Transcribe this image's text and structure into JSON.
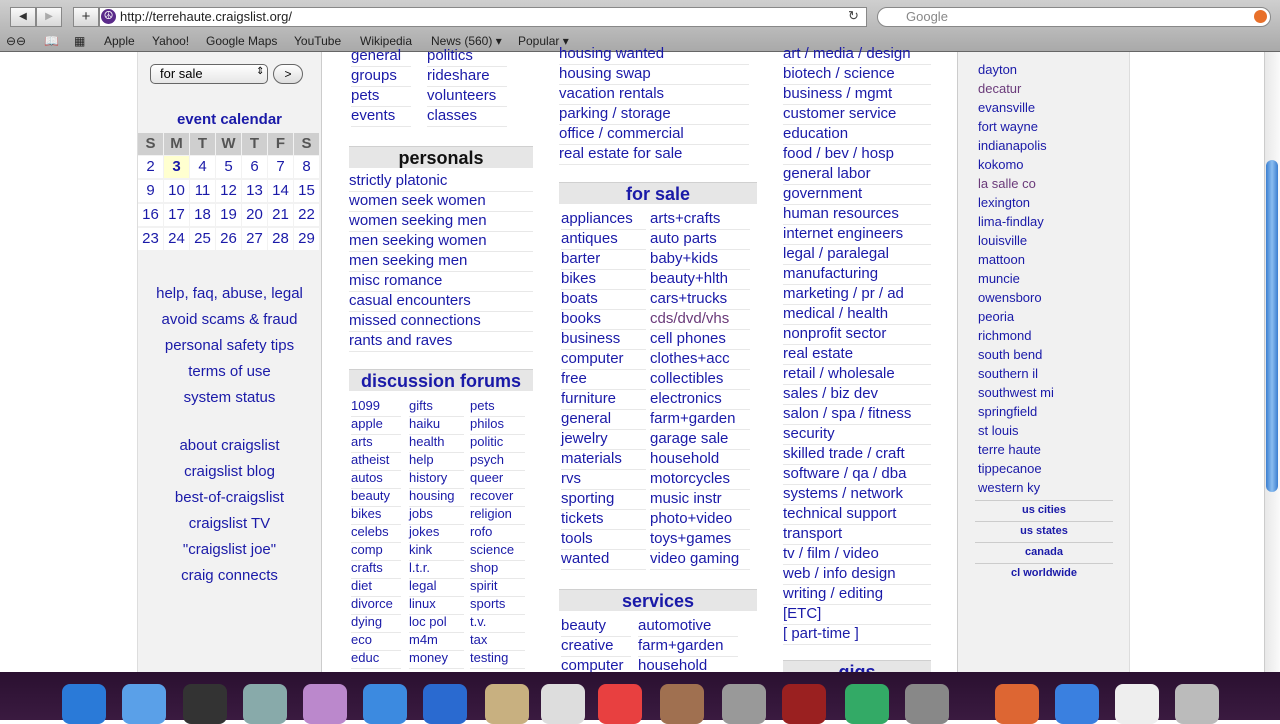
{
  "browser": {
    "url": "http://terrehaute.craigslist.org/",
    "search_placeholder": "Google",
    "bookmarks": [
      "Apple",
      "Yahoo!",
      "Google Maps",
      "YouTube",
      "Wikipedia",
      "News (560) ▾",
      "Popular ▾"
    ]
  },
  "search": {
    "category": "for sale",
    "go": ">"
  },
  "calendar": {
    "title": "event calendar",
    "days": [
      "S",
      "M",
      "T",
      "W",
      "T",
      "F",
      "S"
    ],
    "weeks": [
      [
        "2",
        "3",
        "4",
        "5",
        "6",
        "7",
        "8"
      ],
      [
        "9",
        "10",
        "11",
        "12",
        "13",
        "14",
        "15"
      ],
      [
        "16",
        "17",
        "18",
        "19",
        "20",
        "21",
        "22"
      ],
      [
        "23",
        "24",
        "25",
        "26",
        "27",
        "28",
        "29"
      ]
    ],
    "today": "3"
  },
  "left_links": [
    "help, faq, abuse, legal",
    "avoid scams & fraud",
    "personal safety tips",
    "terms of use",
    "system status"
  ],
  "left_links2": [
    "about craigslist",
    "craigslist blog",
    "best-of-craigslist",
    "craigslist TV",
    "\"craigslist joe\"",
    "craig connects"
  ],
  "community": {
    "col1": [
      "general",
      "groups",
      "pets",
      "events"
    ],
    "col2": [
      "politics",
      "rideshare",
      "volunteers",
      "classes"
    ]
  },
  "personals": {
    "title": "personals",
    "items": [
      "strictly platonic",
      "women seek women",
      "women seeking men",
      "men seeking women",
      "men seeking men",
      "misc romance",
      "casual encounters",
      "missed connections",
      "rants and raves"
    ]
  },
  "forums": {
    "title": "discussion forums",
    "col1": [
      "1099",
      "apple",
      "arts",
      "atheist",
      "autos",
      "beauty",
      "bikes",
      "celebs",
      "comp",
      "crafts",
      "diet",
      "divorce",
      "dying",
      "eco",
      "educ"
    ],
    "col2": [
      "gifts",
      "haiku",
      "health",
      "help",
      "history",
      "housing",
      "jobs",
      "jokes",
      "kink",
      "l.t.r.",
      "legal",
      "linux",
      "loc pol",
      "m4m",
      "money"
    ],
    "col3": [
      "pets",
      "philos",
      "politic",
      "psych",
      "queer",
      "recover",
      "religion",
      "rofo",
      "science",
      "shop",
      "spirit",
      "sports",
      "t.v.",
      "tax",
      "testing"
    ]
  },
  "housing": {
    "items": [
      "housing wanted",
      "housing swap",
      "vacation rentals",
      "parking / storage",
      "office / commercial",
      "real estate for sale"
    ]
  },
  "for_sale": {
    "title": "for sale",
    "col1": [
      "appliances",
      "antiques",
      "barter",
      "bikes",
      "boats",
      "books",
      "business",
      "computer",
      "free",
      "furniture",
      "general",
      "jewelry",
      "materials",
      "rvs",
      "sporting",
      "tickets",
      "tools",
      "wanted"
    ],
    "col2": [
      "arts+crafts",
      "auto parts",
      "baby+kids",
      "beauty+hlth",
      "cars+trucks",
      "cds/dvd/vhs",
      "cell phones",
      "clothes+acc",
      "collectibles",
      "electronics",
      "farm+garden",
      "garage sale",
      "household",
      "motorcycles",
      "music instr",
      "photo+video",
      "toys+games",
      "video gaming"
    ]
  },
  "services": {
    "title": "services",
    "col1": [
      "beauty",
      "creative",
      "computer"
    ],
    "col2": [
      "automotive",
      "farm+garden",
      "household"
    ]
  },
  "jobs": {
    "items": [
      "art / media / design",
      "biotech / science",
      "business / mgmt",
      "customer service",
      "education",
      "food / bev / hosp",
      "general labor",
      "government",
      "human resources",
      "internet engineers",
      "legal / paralegal",
      "manufacturing",
      "marketing / pr / ad",
      "medical / health",
      "nonprofit sector",
      "real estate",
      "retail / wholesale",
      "sales / biz dev",
      "salon / spa / fitness",
      "security",
      "skilled trade / craft",
      "software / qa / dba",
      "systems / network",
      "technical support",
      "transport",
      "tv / film / video",
      "web / info design",
      "writing / editing",
      "[ETC]",
      "[ part-time ]"
    ]
  },
  "gigs": {
    "title": "gigs"
  },
  "nearby": {
    "items": [
      "dayton",
      "decatur",
      "evansville",
      "fort wayne",
      "indianapolis",
      "kokomo",
      "la salle co",
      "lexington",
      "lima-findlay",
      "louisville",
      "mattoon",
      "muncie",
      "owensboro",
      "peoria",
      "richmond",
      "south bend",
      "southern il",
      "southwest mi",
      "springfield",
      "st louis",
      "terre haute",
      "tippecanoe",
      "western ky"
    ],
    "visited": [
      "decatur",
      "la salle co"
    ],
    "more": [
      "us cities",
      "us states",
      "canada",
      "cl worldwide"
    ]
  },
  "colors": {
    "link": "#1a1aa8",
    "visited": "#6a3a7a",
    "header_bg": "#e6e6e6"
  }
}
